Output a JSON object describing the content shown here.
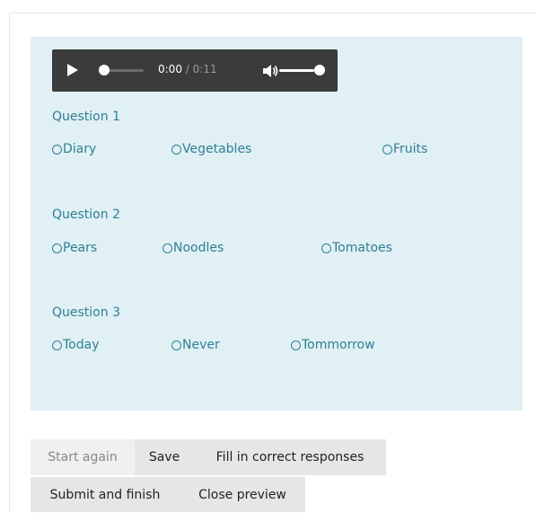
{
  "audio_player": {
    "current_time": "0:00",
    "separator": " / ",
    "duration": "0:11",
    "progress_fraction": 0.0,
    "volume_fraction": 0.85
  },
  "questions": [
    {
      "title": "Question 1",
      "options": [
        "Diary",
        "Vegetables",
        "Fruits"
      ]
    },
    {
      "title": "Question 2",
      "options": [
        "Pears",
        "Noodles",
        "Tomatoes"
      ]
    },
    {
      "title": "Question 3",
      "options": [
        "Today",
        "Never",
        "Tommorrow"
      ]
    }
  ],
  "buttons": {
    "start_again": "Start again",
    "save": "Save",
    "fill_correct": "Fill in correct responses",
    "submit_finish": "Submit and finish",
    "close_preview": "Close preview"
  },
  "colors": {
    "panel_bg": "#e0f0f5",
    "text_accent": "#2f7f93",
    "player_bg": "#3b3b3b",
    "button_bg": "#e6e6e6"
  }
}
